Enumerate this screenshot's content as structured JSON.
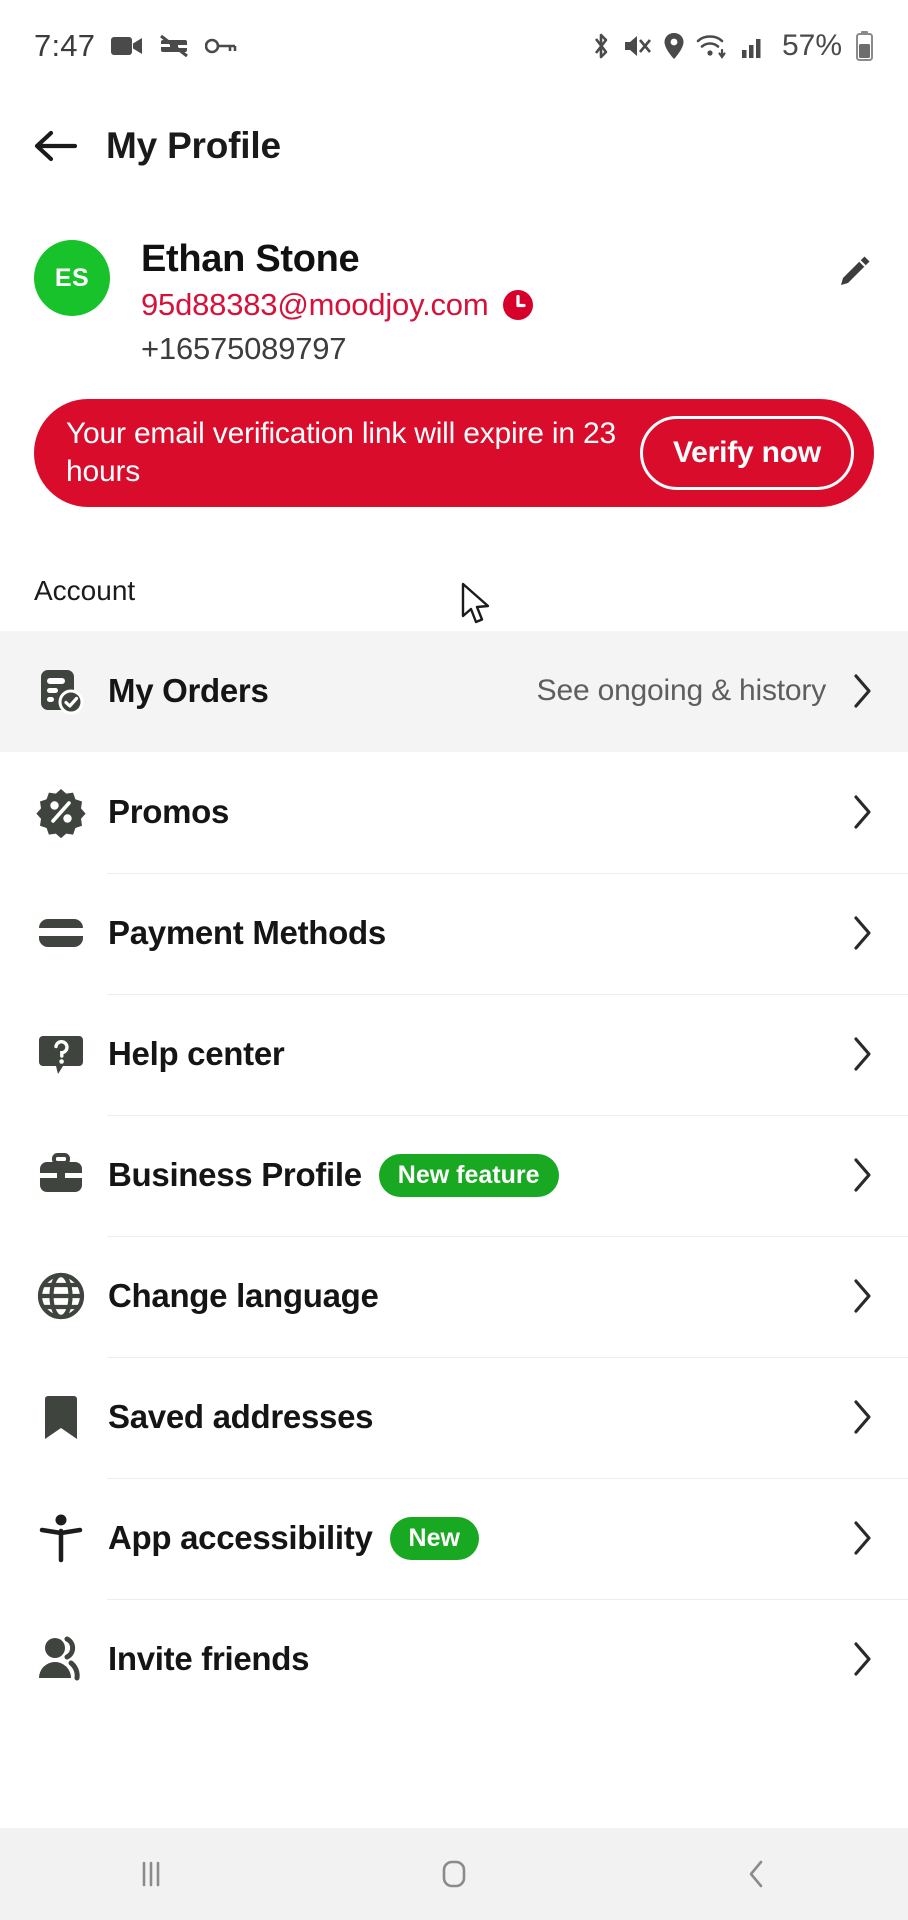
{
  "statusbar": {
    "time": "7:47",
    "battery_percent": "57%",
    "left_icons": [
      "video-camera-icon",
      "no-screenshot-icon",
      "key-icon"
    ],
    "right_icons": [
      "bluetooth-icon",
      "mute-icon",
      "location-icon",
      "wifi-icon",
      "cellular-signal-icon",
      "battery-icon"
    ]
  },
  "appbar": {
    "back_label": "back-arrow",
    "title": "My Profile"
  },
  "profile": {
    "avatar_initials": "ES",
    "avatar_color": "#18c22a",
    "name": "Ethan Stone",
    "email": "95d88383@moodjoy.com",
    "email_color": "#d6123b",
    "email_status_icon": "clock-icon",
    "phone": "+16575089797",
    "edit_icon": "pencil-icon"
  },
  "banner": {
    "message": "Your email verification link will expire in 23 hours",
    "button_label": "Verify now",
    "background": "#da0c2c"
  },
  "sections": [
    {
      "title": "Account",
      "items": [
        {
          "label": "My Orders",
          "icon": "receipt-check-icon",
          "subtitle": "See ongoing & history",
          "badge": "",
          "highlighted": true
        },
        {
          "label": "Promos",
          "icon": "discount-percent-icon",
          "subtitle": "",
          "badge": "",
          "highlighted": false
        },
        {
          "label": "Payment Methods",
          "icon": "credit-card-icon",
          "subtitle": "",
          "badge": "",
          "highlighted": false
        },
        {
          "label": "Help center",
          "icon": "question-bubble-icon",
          "subtitle": "",
          "badge": "",
          "highlighted": false
        },
        {
          "label": "Business Profile",
          "icon": "briefcase-icon",
          "subtitle": "",
          "badge": "New feature",
          "highlighted": false
        },
        {
          "label": "Change language",
          "icon": "globe-icon",
          "subtitle": "",
          "badge": "",
          "highlighted": false
        },
        {
          "label": "Saved addresses",
          "icon": "bookmark-icon",
          "subtitle": "",
          "badge": "",
          "highlighted": false
        },
        {
          "label": "App accessibility",
          "icon": "accessibility-icon",
          "subtitle": "",
          "badge": "New",
          "highlighted": false
        },
        {
          "label": "Invite friends",
          "icon": "people-icon",
          "subtitle": "",
          "badge": "",
          "highlighted": false
        }
      ]
    }
  ],
  "badge_color": "#18a821",
  "navbar": {
    "recents_label": "recents-icon",
    "home_label": "home-icon",
    "back_label": "back-icon"
  }
}
